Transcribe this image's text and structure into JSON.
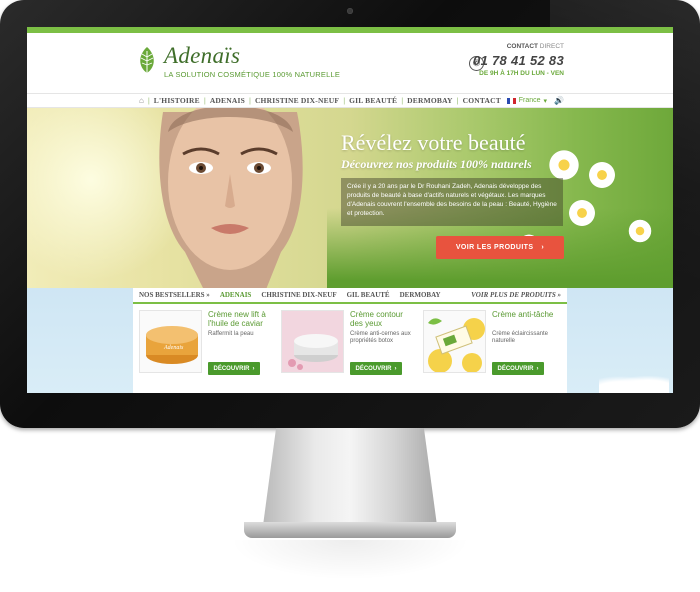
{
  "brand": {
    "name": "Adenaïs",
    "tagline": "LA SOLUTION COSMÉTIQUE 100% NATURELLE",
    "accent": "#7cbf45",
    "dark_green": "#3f6e2a"
  },
  "contact": {
    "label_bold": "CONTACT",
    "label_rest": " DIRECT",
    "phone": "01 78 41 52 83",
    "hours": "DE 9H À 17H DU LUN - VEN"
  },
  "nav": {
    "items": [
      "L'HISTOIRE",
      "ADENAIS",
      "CHRISTINE DIX-NEUF",
      "GIL BEAUTÉ",
      "DERMOBAY",
      "CONTACT"
    ],
    "language": "France",
    "icons": [
      "home-icon",
      "speaker-icon"
    ]
  },
  "hero": {
    "title": "Révélez votre beauté",
    "subtitle": "Découvrez nos produits 100% naturels",
    "text": "Crée il y a 20 ans par le Dr Rouhani Zadeh, Adenais développe des produits de beauté à base d'actifs naturels et végétaux. Les marques d'Adenais couvrent l'ensemble des besoins de la peau : Beauté, Hygiène et protection.",
    "button": "VOIR LES PRODUITS",
    "button_arrow": "›",
    "button_color": "#e8533e"
  },
  "bestsellers": {
    "tabs": [
      "NOS BESTSELLERS »",
      "ADENAIS",
      "CHRISTINE DIX-NEUF",
      "GIL BEAUTÉ",
      "DERMOBAY"
    ],
    "more": "VOIR PLUS DE PRODUITS »",
    "products": [
      {
        "name": "Crème new lift à l'huile de caviar",
        "desc": "Raffermit la peau",
        "button": "DÉCOUVRIR"
      },
      {
        "name": "Crème contour des yeux",
        "desc": "Crème anti-cernes aux propriétés botox",
        "button": "DÉCOUVRIR"
      },
      {
        "name": "Crème anti-tâche",
        "desc": "Crème éclaircissante naturelle",
        "button": "DÉCOUVRIR"
      }
    ]
  }
}
